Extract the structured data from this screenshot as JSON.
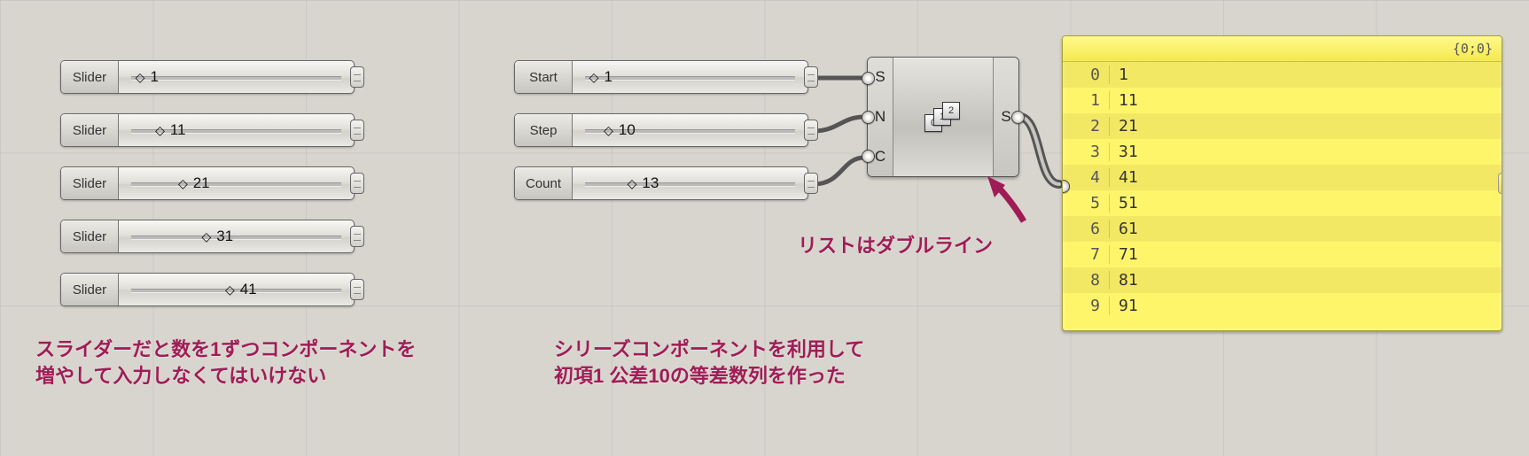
{
  "sliders_left": [
    {
      "label": "Slider",
      "value": "1",
      "pos_pct": 12
    },
    {
      "label": "Slider",
      "value": "11",
      "pos_pct": 22
    },
    {
      "label": "Slider",
      "value": "21",
      "pos_pct": 32
    },
    {
      "label": "Slider",
      "value": "31",
      "pos_pct": 42
    },
    {
      "label": "Slider",
      "value": "41",
      "pos_pct": 52
    }
  ],
  "sliders_right": [
    {
      "label": "Start",
      "value": "1",
      "pos_pct": 12
    },
    {
      "label": "Step",
      "value": "10",
      "pos_pct": 20
    },
    {
      "label": "Count",
      "value": "13",
      "pos_pct": 30
    }
  ],
  "series_node": {
    "inputs": [
      "S",
      "N",
      "C"
    ],
    "output": "S",
    "tiles": [
      "0",
      "1",
      "2"
    ]
  },
  "panel": {
    "header": "{0;0}",
    "rows": [
      {
        "i": "0",
        "v": "1"
      },
      {
        "i": "1",
        "v": "11"
      },
      {
        "i": "2",
        "v": "21"
      },
      {
        "i": "3",
        "v": "31"
      },
      {
        "i": "4",
        "v": "41"
      },
      {
        "i": "5",
        "v": "51"
      },
      {
        "i": "6",
        "v": "61"
      },
      {
        "i": "7",
        "v": "71"
      },
      {
        "i": "8",
        "v": "81"
      },
      {
        "i": "9",
        "v": "91"
      }
    ]
  },
  "captions": {
    "left_line1": "スライダーだと数を1ずつコンポーネントを",
    "left_line2": "増やして入力しなくてはいけない",
    "right_line1": "シリーズコンポーネントを利用して",
    "right_line2": "初項1 公差10の等差数列を作った",
    "arrow_label": "リストはダブルライン"
  },
  "colors": {
    "accent": "#a01c56",
    "panel": "#fff56a"
  }
}
